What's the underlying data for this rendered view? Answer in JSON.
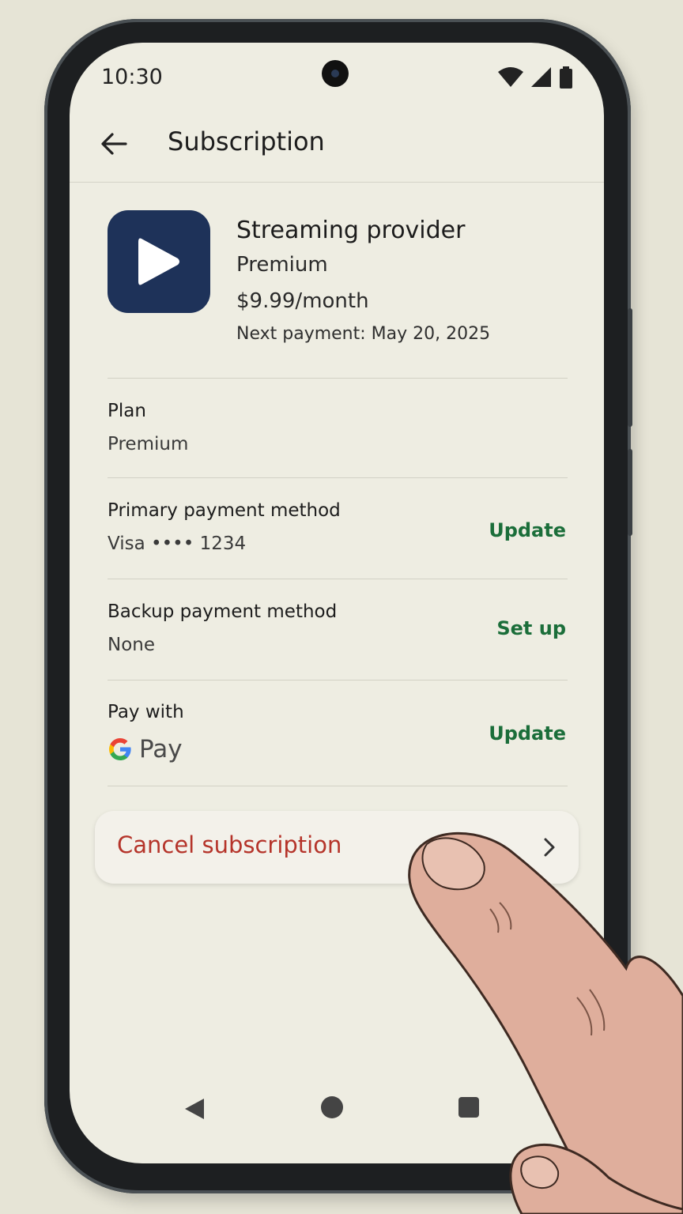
{
  "status_bar": {
    "time": "10:30",
    "icons": [
      "wifi-icon",
      "signal-icon",
      "battery-icon"
    ]
  },
  "app_bar": {
    "back_icon": "arrow-back-icon",
    "title": "Subscription"
  },
  "subscription": {
    "icon": "play-icon",
    "icon_color": "#1e3259",
    "name": "Streaming provider",
    "plan": "Premium",
    "price": "$9.99/month",
    "next_payment": "Next payment: May 20, 2025"
  },
  "rows": {
    "plan": {
      "label": "Plan",
      "value": "Premium"
    },
    "primary_payment": {
      "label": "Primary payment method",
      "value": "Visa •••• 1234",
      "action": "Update"
    },
    "backup_payment": {
      "label": "Backup payment method",
      "value": "None",
      "action": "Set up"
    },
    "pay_with": {
      "label": "Pay with",
      "value": "Pay",
      "action": "Update",
      "logo": "google-g-icon"
    }
  },
  "cancel": {
    "label": "Cancel subscription",
    "icon": "chevron-right-icon",
    "color": "#b5342a"
  },
  "nav_bar": {
    "items": [
      "nav-back-icon",
      "nav-home-icon",
      "nav-recents-icon"
    ]
  },
  "colors": {
    "action": "#1b6e3a",
    "background": "#eeede2"
  }
}
